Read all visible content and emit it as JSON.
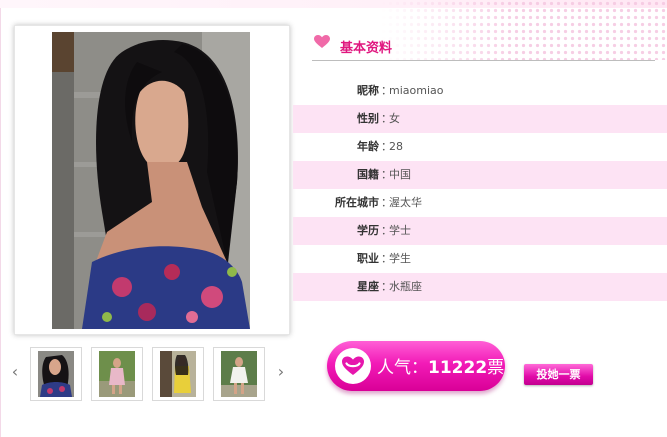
{
  "colors": {
    "accent": "#e0177f",
    "row_alt": "#fde3f4",
    "badge": "#f21bb7"
  },
  "section": {
    "title": "基本资料",
    "icon": "heart-icon"
  },
  "profile": {
    "rows": [
      {
        "label": "昵称",
        "value": "miaomiao"
      },
      {
        "label": "性别",
        "value": "女"
      },
      {
        "label": "年龄",
        "value": "28"
      },
      {
        "label": "国籍",
        "value": "中国"
      },
      {
        "label": "所在城市",
        "value": "渥太华"
      },
      {
        "label": "学历",
        "value": "学士"
      },
      {
        "label": "职业",
        "value": "学生"
      },
      {
        "label": "星座",
        "value": "水瓶座"
      }
    ],
    "colon": "："
  },
  "popularity": {
    "label": "人气：",
    "count": "11222",
    "unit": "票",
    "icon": "heart-icon"
  },
  "vote_button": {
    "label": "投她一票"
  },
  "gallery": {
    "prev_icon": "chevron-left-icon",
    "next_icon": "chevron-right-icon",
    "thumb_count": 4
  }
}
